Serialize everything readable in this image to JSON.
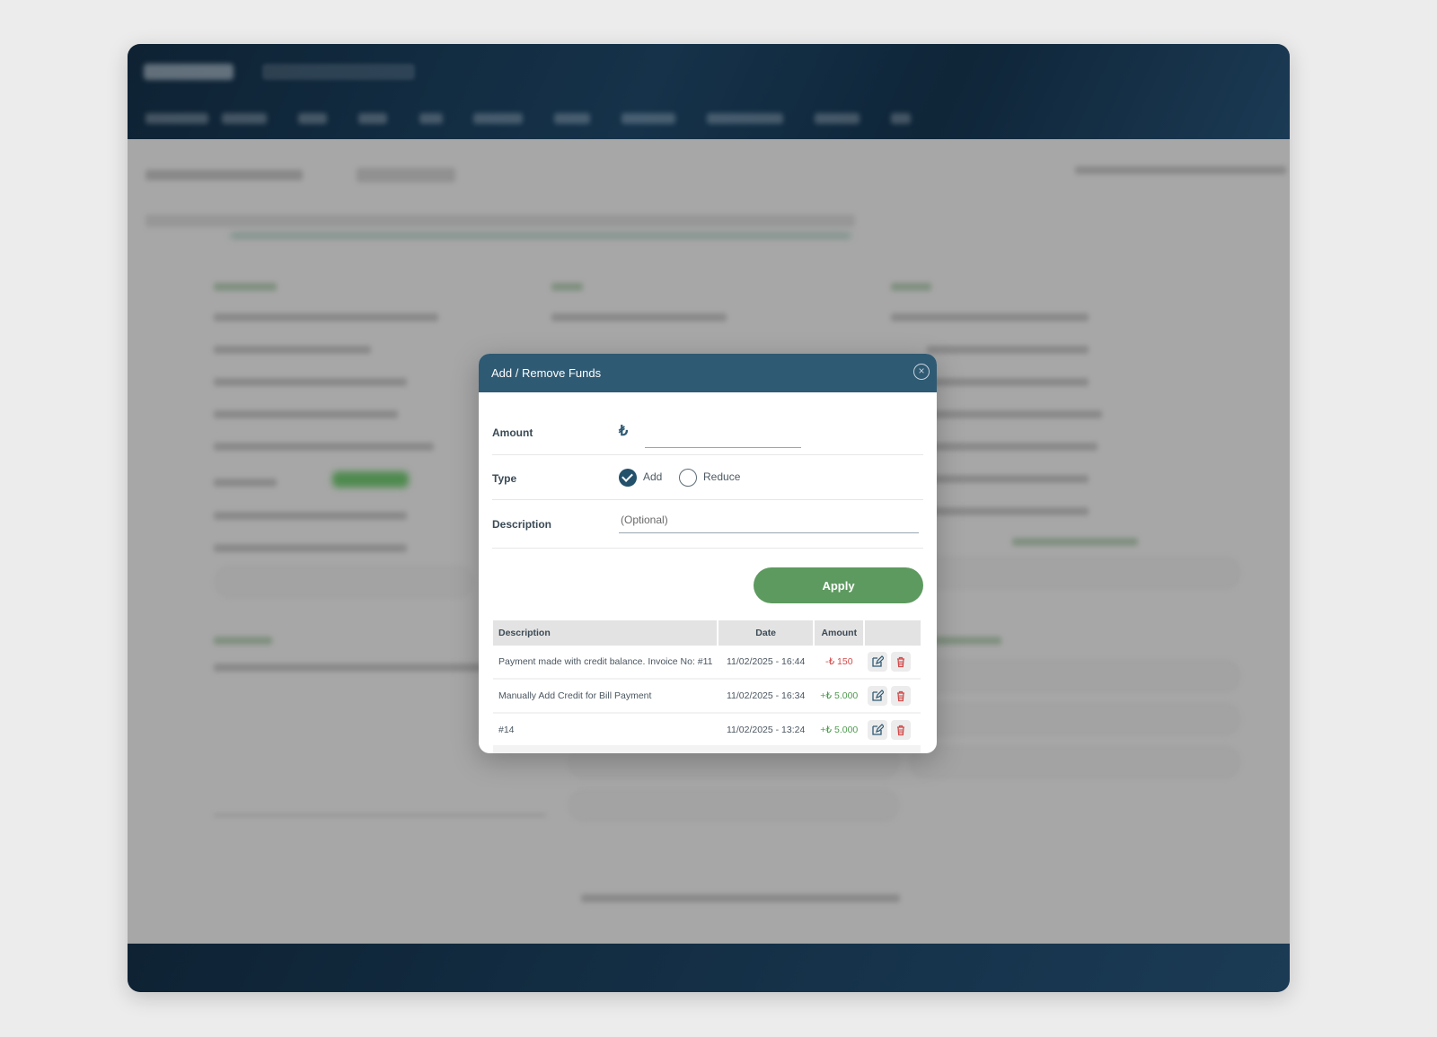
{
  "modal": {
    "title": "Add / Remove Funds",
    "close_icon": "close-icon",
    "amount_label": "Amount",
    "currency_symbol": "₺",
    "amount_value": "",
    "type_label": "Type",
    "type_options": [
      {
        "label": "Add",
        "selected": true
      },
      {
        "label": "Reduce",
        "selected": false
      }
    ],
    "description_label": "Description",
    "description_placeholder": "(Optional)",
    "apply_label": "Apply"
  },
  "history": {
    "headers": {
      "description": "Description",
      "date": "Date",
      "amount": "Amount"
    },
    "rows": [
      {
        "description": "Payment made with credit balance. Invoice No: #11",
        "date": "11/02/2025 - 16:44",
        "amount": "-₺ 150"
      },
      {
        "description": "Manually Add Credit for Bill Payment",
        "date": "11/02/2025 - 16:34",
        "amount": "+₺ 5.000"
      },
      {
        "description": "#14",
        "date": "11/02/2025 - 13:24",
        "amount": "+₺ 5.000"
      }
    ]
  },
  "colors": {
    "header_bg": "#2f5a73",
    "apply_bg": "#5d9a5f",
    "negative": "#d24a4a",
    "positive": "#4f9a4f",
    "nav_bg": "#15324a"
  }
}
